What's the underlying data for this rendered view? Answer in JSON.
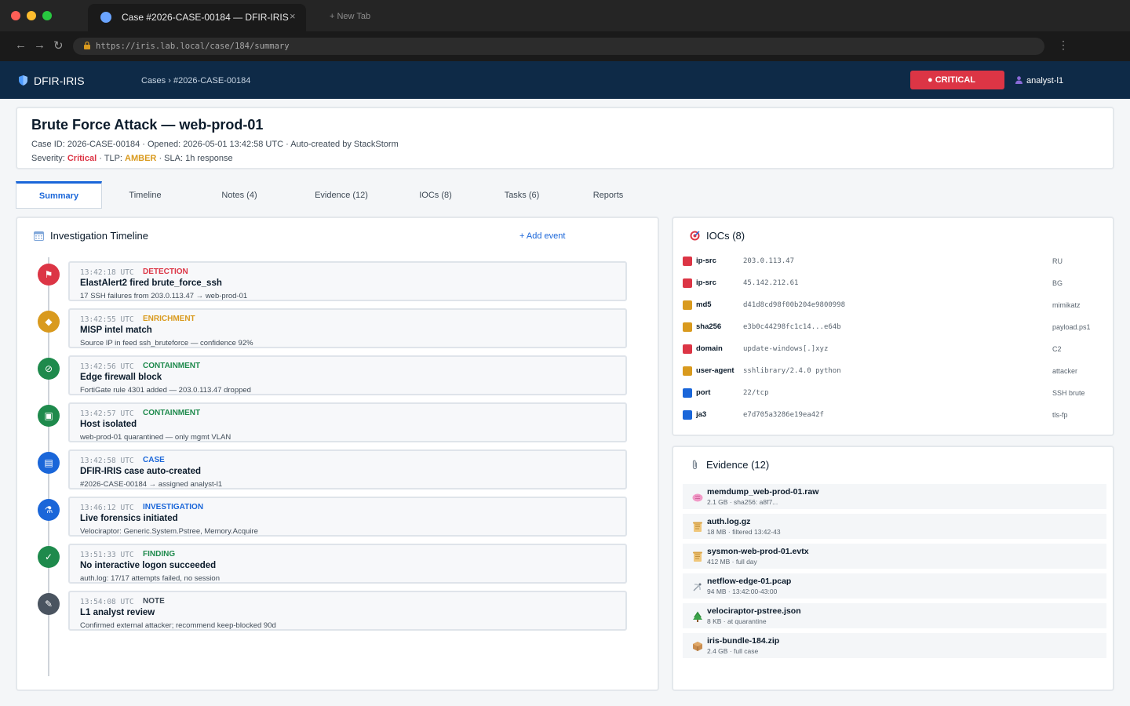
{
  "browser": {
    "tab_title": "Case #2026-CASE-00184 — DFIR-IRIS",
    "tab_close": "×",
    "new_tab": "+ New Tab",
    "url": "https://iris.lab.local/case/184/summary",
    "back": "←",
    "forward": "→",
    "reload": "↻",
    "menu": "⋮",
    "colors": {
      "close": "#ff5f57",
      "minimize": "#febc2e",
      "maximize": "#28c840"
    }
  },
  "header": {
    "brand": "DFIR-IRIS",
    "breadcrumb": "Cases › #2026-CASE-00184",
    "severity_badge": "● CRITICAL",
    "user": "analyst-l1",
    "colors": {
      "bar": "#0e2a47",
      "badge": "#dc3545"
    }
  },
  "case": {
    "title": "Brute Force Attack — web-prod-01",
    "meta": "Case ID: 2026-CASE-00184 · Opened: 2026-05-01 13:42:58 UTC · Auto-created by StackStorm",
    "severity_label": "Severity:",
    "severity": "Critical",
    "tlp_label": "· TLP:",
    "tlp": "AMBER",
    "sla": "· SLA: 1h response"
  },
  "tabs": [
    "Summary",
    "Timeline",
    "Notes (4)",
    "Evidence (12)",
    "IOCs (8)",
    "Tasks (6)",
    "Reports"
  ],
  "timeline": {
    "title": "Investigation Timeline",
    "add_event": "+ Add event",
    "events": [
      {
        "time": "13:42:18 UTC",
        "category": "DETECTION",
        "cat_color": "#dc3545",
        "circle_color": "#dc3545",
        "icon": "alarm-icon",
        "glyph": "⚑",
        "title": "ElastAlert2 fired brute_force_ssh",
        "detail": "17 SSH failures from 203.0.113.47 → web-prod-01"
      },
      {
        "time": "13:42:55 UTC",
        "category": "ENRICHMENT",
        "cat_color": "#d99a1e",
        "circle_color": "#d99a1e",
        "icon": "shield-icon",
        "glyph": "◆",
        "title": "MISP intel match",
        "detail": "Source IP in feed ssh_bruteforce — confidence 92%"
      },
      {
        "time": "13:42:56 UTC",
        "category": "CONTAINMENT",
        "cat_color": "#1e8a4c",
        "circle_color": "#1e8a4c",
        "icon": "block-icon",
        "glyph": "⊘",
        "title": "Edge firewall block",
        "detail": "FortiGate rule 4301 added — 203.0.113.47 dropped"
      },
      {
        "time": "13:42:57 UTC",
        "category": "CONTAINMENT",
        "cat_color": "#1e8a4c",
        "circle_color": "#1e8a4c",
        "icon": "lock-icon",
        "glyph": "▣",
        "title": "Host isolated",
        "detail": "web-prod-01 quarantined — only mgmt VLAN"
      },
      {
        "time": "13:42:58 UTC",
        "category": "CASE",
        "cat_color": "#1a66d9",
        "circle_color": "#1a66d9",
        "icon": "clipboard-icon",
        "glyph": "▤",
        "title": "DFIR-IRIS case auto-created",
        "detail": "#2026-CASE-00184 → assigned analyst-l1"
      },
      {
        "time": "13:46:12 UTC",
        "category": "INVESTIGATION",
        "cat_color": "#1a66d9",
        "circle_color": "#1a66d9",
        "icon": "microscope-icon",
        "glyph": "⚗",
        "title": "Live forensics initiated",
        "detail": "Velociraptor: Generic.System.Pstree, Memory.Acquire"
      },
      {
        "time": "13:51:33 UTC",
        "category": "FINDING",
        "cat_color": "#1e8a4c",
        "circle_color": "#1e8a4c",
        "icon": "check-icon",
        "glyph": "✓",
        "title": "No interactive logon succeeded",
        "detail": "auth.log: 17/17 attempts failed, no session"
      },
      {
        "time": "13:54:08 UTC",
        "category": "NOTE",
        "cat_color": "#3f4b57",
        "circle_color": "#4a5460",
        "icon": "note-icon",
        "glyph": "✎",
        "title": "L1 analyst review",
        "detail": "Confirmed external attacker; recommend keep-blocked 90d"
      }
    ]
  },
  "iocs": {
    "title": "IOCs (8)",
    "rows": [
      {
        "type": "ip-src",
        "value": "203.0.113.47",
        "tag": "RU",
        "color": "#dc3545"
      },
      {
        "type": "ip-src",
        "value": "45.142.212.61",
        "tag": "BG",
        "color": "#dc3545"
      },
      {
        "type": "md5",
        "value": "d41d8cd98f00b204e9800998",
        "tag": "mimikatz",
        "color": "#d99a1e"
      },
      {
        "type": "sha256",
        "value": "e3b0c44298fc1c14...e64b",
        "tag": "payload.ps1",
        "color": "#d99a1e"
      },
      {
        "type": "domain",
        "value": "update-windows[.]xyz",
        "tag": "C2",
        "color": "#dc3545"
      },
      {
        "type": "user-agent",
        "value": "sshlibrary/2.4.0 python",
        "tag": "attacker",
        "color": "#d99a1e"
      },
      {
        "type": "port",
        "value": "22/tcp",
        "tag": "SSH brute",
        "color": "#1a66d9"
      },
      {
        "type": "ja3",
        "value": "e7d705a3286e19ea42f",
        "tag": "tls-fp",
        "color": "#1a66d9"
      }
    ]
  },
  "evidence": {
    "title": "Evidence (12)",
    "items": [
      {
        "name": "memdump_web-prod-01.raw",
        "meta": "2.1 GB · sha256: a8f7...",
        "icon": "brain-icon",
        "color": "#e86fb0"
      },
      {
        "name": "auth.log.gz",
        "meta": "18 MB · filtered 13:42-43",
        "icon": "scroll-icon",
        "color": "#e0a84a"
      },
      {
        "name": "sysmon-web-prod-01.evtx",
        "meta": "412 MB · full day",
        "icon": "scroll-icon",
        "color": "#e0a84a"
      },
      {
        "name": "netflow-edge-01.pcap",
        "meta": "94 MB · 13:42:00-43:00",
        "icon": "satellite-icon",
        "color": "#9aa3ad"
      },
      {
        "name": "velociraptor-pstree.json",
        "meta": "8 KB · at quarantine",
        "icon": "tree-icon",
        "color": "#2e8b3a"
      },
      {
        "name": "iris-bundle-184.zip",
        "meta": "2.4 GB · full case",
        "icon": "package-icon",
        "color": "#b5793a"
      }
    ]
  }
}
